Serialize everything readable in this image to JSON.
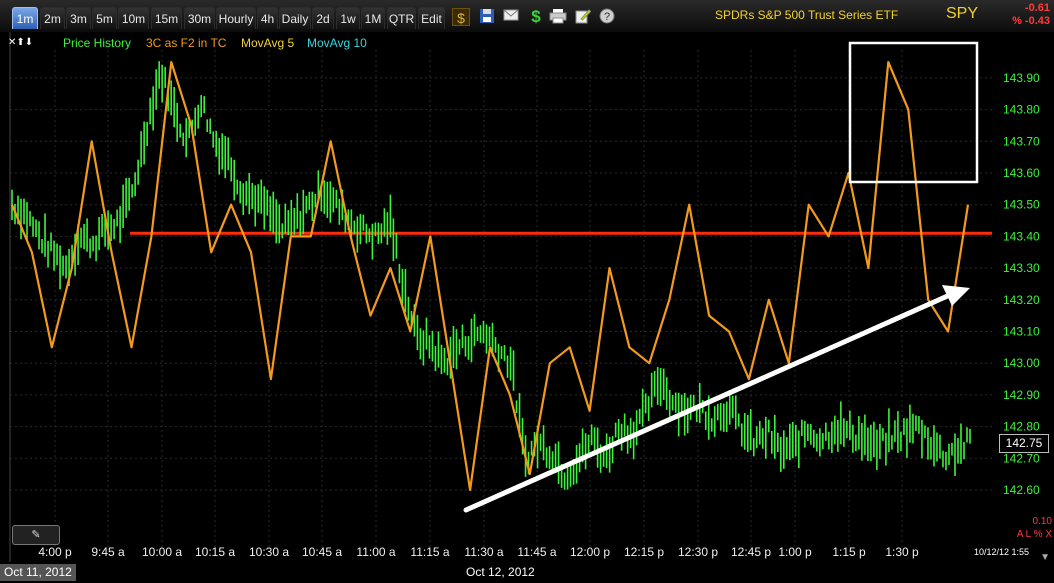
{
  "toolbar": {
    "timeframes": [
      {
        "label": "1m",
        "active": true
      },
      {
        "label": "2m"
      },
      {
        "label": "3m"
      },
      {
        "label": "5m"
      },
      {
        "label": "10m"
      },
      {
        "label": "15m"
      },
      {
        "label": "30m"
      },
      {
        "label": "Hourly"
      },
      {
        "label": "4h"
      },
      {
        "label": "Daily"
      },
      {
        "label": "2d"
      },
      {
        "label": "1w"
      },
      {
        "label": "1M"
      },
      {
        "label": "QTR"
      },
      {
        "label": "Edit"
      }
    ],
    "icons": [
      "dollar-icon",
      "save-icon",
      "email-icon",
      "money-icon",
      "print-icon",
      "edit-icon",
      "help-icon"
    ],
    "title": "SPDRs S&P 500 Trust Series ETF",
    "symbol": "SPY",
    "change": "-0.61",
    "change_pct": "% -0.43"
  },
  "legend": {
    "arrows": "✕⬆⬇",
    "price_history": "Price History",
    "indicator": "3C as F2 in TC",
    "ma5": "MovAvg 5",
    "ma10": "MovAvg 10"
  },
  "colors": {
    "price": "#3cf23c",
    "indicator": "#f39a1e",
    "ma5": "#f2d230",
    "ma10": "#35d7e0",
    "resistance": "#ff2a0a",
    "annotation": "#ffffff",
    "accent": "#2e5fb4"
  },
  "chart_data": {
    "type": "line",
    "y_axis_ticks": [
      "143.90",
      "143.80",
      "143.70",
      "143.60",
      "143.50",
      "143.40",
      "143.30",
      "143.20",
      "143.10",
      "143.00",
      "142.90",
      "142.80",
      "142.70",
      "142.60"
    ],
    "x_axis_ticks": [
      "4:00 p",
      "9:45 a",
      "10:00 a",
      "10:15 a",
      "10:30 a",
      "10:45 a",
      "11:00 a",
      "11:15 a",
      "11:30 a",
      "11:45 a",
      "12:00 p",
      "12:15 p",
      "12:30 p",
      "12:45 p",
      "1:00 p",
      "1:15 p",
      "1:30 p"
    ],
    "ylim": [
      142.5,
      144.0
    ],
    "current_price": "142.75",
    "series": [
      {
        "name": "Price History",
        "style": "bars",
        "values": [
          143.5,
          143.47,
          143.4,
          143.35,
          143.3,
          143.4,
          143.38,
          143.42,
          143.45,
          143.55,
          143.75,
          143.92,
          143.8,
          143.7,
          143.83,
          143.7,
          143.65,
          143.55,
          143.52,
          143.48,
          143.42,
          143.45,
          143.5,
          143.55,
          143.5,
          143.45,
          143.42,
          143.4,
          143.45,
          143.25,
          143.08,
          143.06,
          143.0,
          143.05,
          143.08,
          143.1,
          143.05,
          143.0,
          142.7,
          142.75,
          142.72,
          142.65,
          142.7,
          142.76,
          142.7,
          142.8,
          142.78,
          142.85,
          142.95,
          142.88,
          142.85,
          142.86,
          142.83,
          142.86,
          142.8,
          142.75,
          142.78,
          142.72,
          142.74,
          142.79,
          142.76,
          142.8,
          142.78,
          142.77,
          142.73,
          142.76,
          142.78,
          142.8,
          142.76,
          142.71,
          142.73,
          142.75
        ]
      },
      {
        "name": "3C as F2 in TC",
        "style": "line",
        "values": [
          143.5,
          143.35,
          143.05,
          143.3,
          143.7,
          143.35,
          143.05,
          143.4,
          143.95,
          143.75,
          143.35,
          143.5,
          143.35,
          142.95,
          143.4,
          143.4,
          143.7,
          143.4,
          143.15,
          143.3,
          143.1,
          143.4,
          143.0,
          142.6,
          143.05,
          142.9,
          142.65,
          143.0,
          143.05,
          142.85,
          143.3,
          143.05,
          143.0,
          143.2,
          143.5,
          143.15,
          143.1,
          142.95,
          143.2,
          143.0,
          143.5,
          143.4,
          143.6,
          143.3,
          143.95,
          143.8,
          143.2,
          143.1,
          143.5
        ]
      }
    ],
    "annotations": {
      "resistance_level": 143.41,
      "trend_arrow": "upward",
      "highlight_box": true
    }
  },
  "footer": {
    "date_left": "Oct 11, 2012",
    "date_mid": "Oct 12, 2012",
    "timestamp": "10/12/12 1:55",
    "scale_value": "0.10",
    "axis_controls": "A L % X"
  }
}
